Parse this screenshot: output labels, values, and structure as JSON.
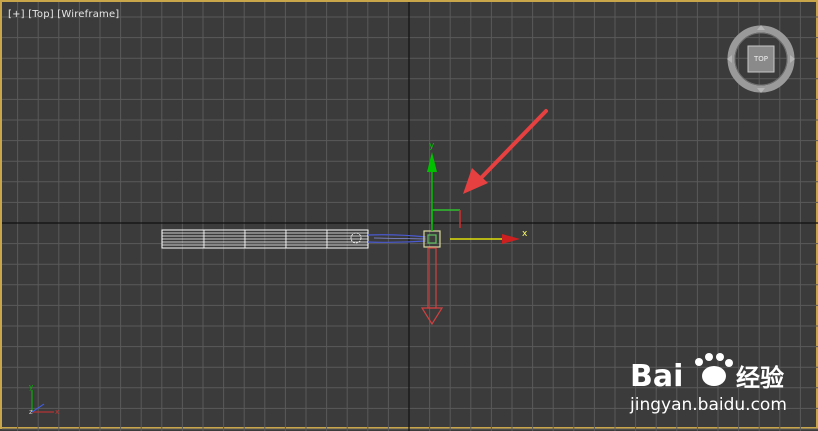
{
  "viewport": {
    "labels": [
      "[+]",
      "[Top]",
      "[Wireframe]"
    ],
    "border_color": "#c9a64a",
    "background": "#3b3b3b",
    "grid_minor_color": "#5a5a5a",
    "grid_major_color": "#111111"
  },
  "viewcube": {
    "face_label": "TOP"
  },
  "gizmo": {
    "x_label": "x",
    "y_label": "y",
    "x_color": "#ffff00",
    "y_color": "#00c000",
    "z_color": "#ff3333"
  },
  "axis_tripod": {
    "x_label": "x",
    "y_label": "y",
    "z_label": "z"
  },
  "annotation_arrow": {
    "color": "#e64040"
  },
  "watermark": {
    "brand": "Bai",
    "brand_suffix": "经验",
    "url": "jingyan.baidu.com"
  }
}
